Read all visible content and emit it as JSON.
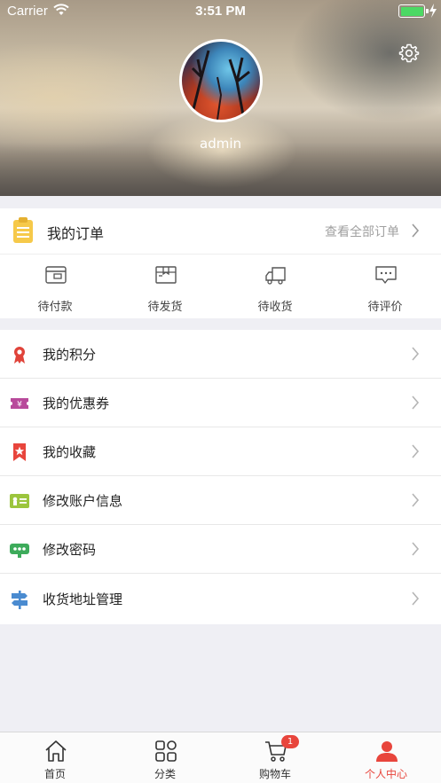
{
  "status_bar": {
    "carrier": "Carrier",
    "time": "3:51 PM",
    "battery_color": "#4cd964"
  },
  "profile": {
    "username": "admin",
    "settings_icon": "gear-icon",
    "avatar_icon": "avatar-photo"
  },
  "orders": {
    "title": "我的订单",
    "view_all": "查看全部订单",
    "icon": "clipboard-icon",
    "items": [
      {
        "label": "待付款",
        "icon": "wallet-icon"
      },
      {
        "label": "待发货",
        "icon": "package-icon"
      },
      {
        "label": "待收货",
        "icon": "truck-icon"
      },
      {
        "label": "待评价",
        "icon": "chat-bubble-icon"
      }
    ]
  },
  "menu": {
    "items": [
      {
        "label": "我的积分",
        "icon": "award-ribbon-icon",
        "color": "#e0433a"
      },
      {
        "label": "我的优惠券",
        "icon": "coupon-ticket-icon",
        "color": "#b84a9b"
      },
      {
        "label": "我的收藏",
        "icon": "bookmark-star-icon",
        "color": "#e8453c"
      },
      {
        "label": "修改账户信息",
        "icon": "id-card-icon",
        "color": "#9bc53d"
      },
      {
        "label": "修改密码",
        "icon": "password-icon",
        "color": "#3dab5b"
      },
      {
        "label": "收货地址管理",
        "icon": "signpost-icon",
        "color": "#4a8bd0"
      }
    ]
  },
  "tabbar": {
    "accent": "#e8453c",
    "tabs": [
      {
        "label": "首页",
        "icon": "home-icon"
      },
      {
        "label": "分类",
        "icon": "grid-icon"
      },
      {
        "label": "购物车",
        "icon": "cart-icon",
        "badge": "1"
      },
      {
        "label": "个人中心",
        "icon": "person-icon",
        "active": true
      }
    ]
  }
}
